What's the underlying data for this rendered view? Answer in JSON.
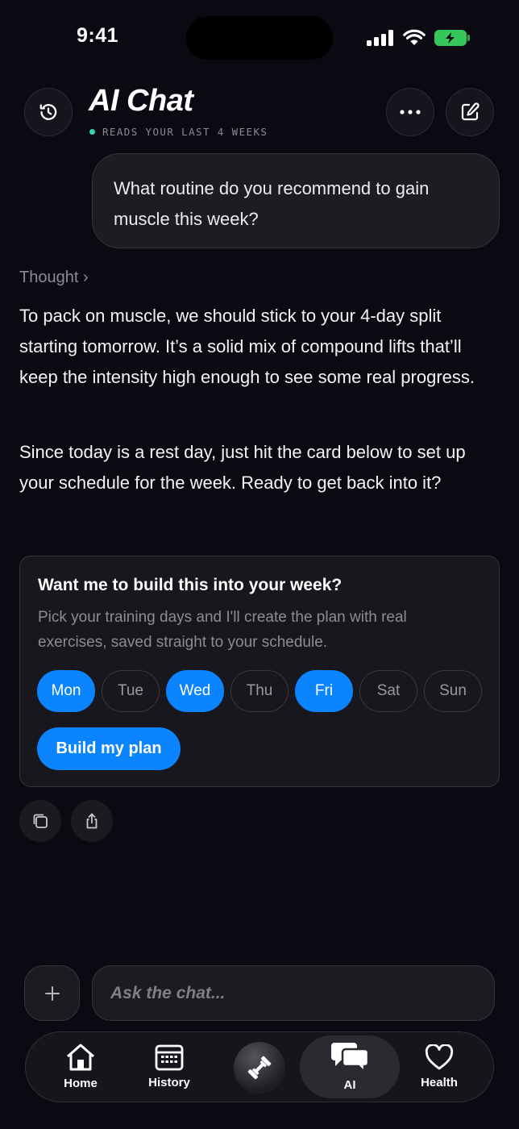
{
  "status_bar": {
    "time": "9:41"
  },
  "header": {
    "title": "AI Chat",
    "subtitle": "READS YOUR LAST 4 WEEKS"
  },
  "conversation": {
    "user_message": "What routine do you recommend to gain muscle this week?",
    "thought_label": "Thought ›",
    "paragraphs": [
      "To pack on muscle, we should stick to your 4-day split starting tomorrow. It’s a solid mix of compound lifts that’ll keep the intensity high enough to see some real progress.",
      "Since today is a rest day, just hit the card below to set up your schedule for the week. Ready to get back into it?"
    ]
  },
  "plan_card": {
    "title": "Want me to build this into your week?",
    "description": "Pick your training days and I'll create the plan with real exercises, saved straight to your schedule.",
    "days": [
      {
        "label": "Mon",
        "selected": true
      },
      {
        "label": "Tue",
        "selected": false
      },
      {
        "label": "Wed",
        "selected": true
      },
      {
        "label": "Thu",
        "selected": false
      },
      {
        "label": "Fri",
        "selected": true
      },
      {
        "label": "Sat",
        "selected": false
      },
      {
        "label": "Sun",
        "selected": false
      }
    ],
    "build_label": "Build my plan"
  },
  "composer": {
    "placeholder": "Ask the chat..."
  },
  "tabs": {
    "home": "Home",
    "history": "History",
    "ai": "AI",
    "health": "Health"
  },
  "colors": {
    "background": "#0b0a12",
    "accent": "#0a84ff",
    "status_dot": "#35d2b4",
    "battery": "#35c759"
  }
}
